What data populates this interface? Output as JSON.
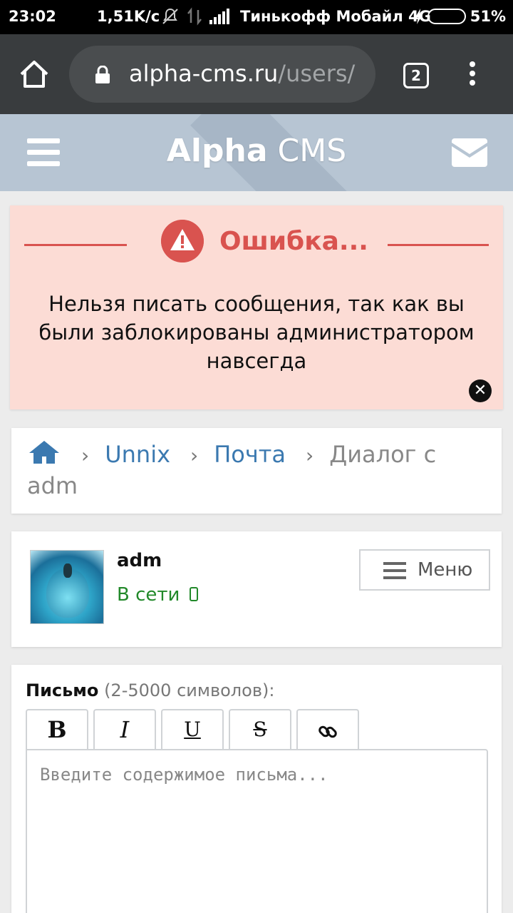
{
  "status_bar": {
    "time": "23:02",
    "speed": "1,51K/c",
    "carrier": "Тинькофф Мобайл 4G",
    "battery": "51%",
    "battery_level": 0.51,
    "battery_color": "#42d44a"
  },
  "browser": {
    "url_host": "alpha-cms.ru",
    "url_path": "/users/",
    "tab_count": "2"
  },
  "header": {
    "title_bold": "Alpha",
    "title_rest": " CMS"
  },
  "error": {
    "title": "Ошибка...",
    "message": "Нельзя писать сообщения, так как вы были заблокированы администратором навсегда",
    "accent_color": "#d9534f"
  },
  "breadcrumbs": {
    "items": [
      "Unnix",
      "Почта"
    ],
    "current": "Диалог с adm"
  },
  "user": {
    "name": "adm",
    "status": "В сети",
    "status_color": "#22892a",
    "menu_label": "Меню"
  },
  "compose": {
    "label": "Письмо",
    "hint": "(2-5000 символов):",
    "placeholder": "Введите содержимое письма...",
    "toolbar": [
      "B",
      "I",
      "U",
      "S",
      "link-icon"
    ]
  }
}
